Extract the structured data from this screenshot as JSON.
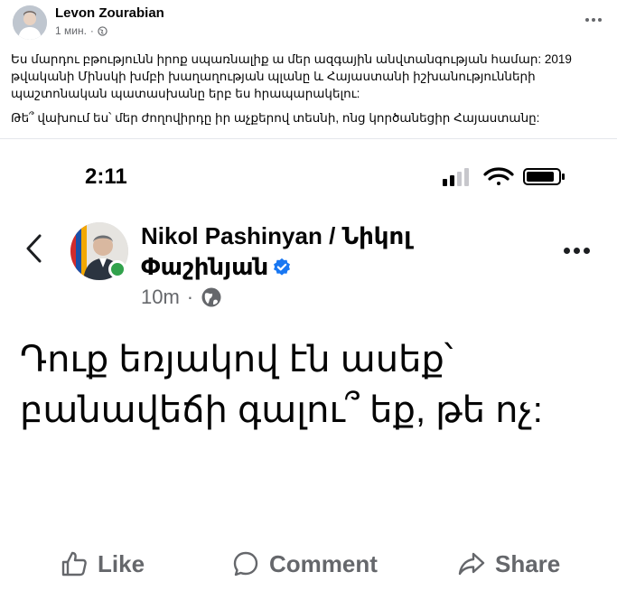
{
  "post": {
    "author": "Levon Zourabian",
    "time": "1 мин.",
    "paragraphs": [
      "Ես մարդու բթությունն իրոք սպառնալիք ա մեր ազգային անվտանգության համար: 2019 թվականի Մինսկի խմբի խաղաղության պլանը և Հայաստանի իշխանությունների պաշտոնական պատասխանը երբ ես հրապարակելու:",
      "Թե՞ վախում ես՝ մեր ժողովիրդը իր աչքերով տեսնի, ոնց կործանեցիր Հայաստանը:"
    ]
  },
  "screenshot": {
    "status_time": "2:11",
    "author": "Nikol Pashinyan / Նիկոլ Փաշինյան",
    "time": "10m",
    "body": "Դուք եռյակով էն ասեք՝ բանավեճի գալու՞ եք, թե ոչ:",
    "actions": {
      "like": "Like",
      "comment": "Comment",
      "share": "Share"
    }
  },
  "colors": {
    "verified": "#1877f2",
    "online": "#31a24c",
    "meta_gray": "#65676b"
  },
  "icons": [
    "globe-icon",
    "more-icon",
    "back-chevron-icon",
    "verified-badge-icon",
    "like-icon",
    "comment-icon",
    "share-icon",
    "signal-icon",
    "wifi-icon",
    "battery-icon"
  ]
}
